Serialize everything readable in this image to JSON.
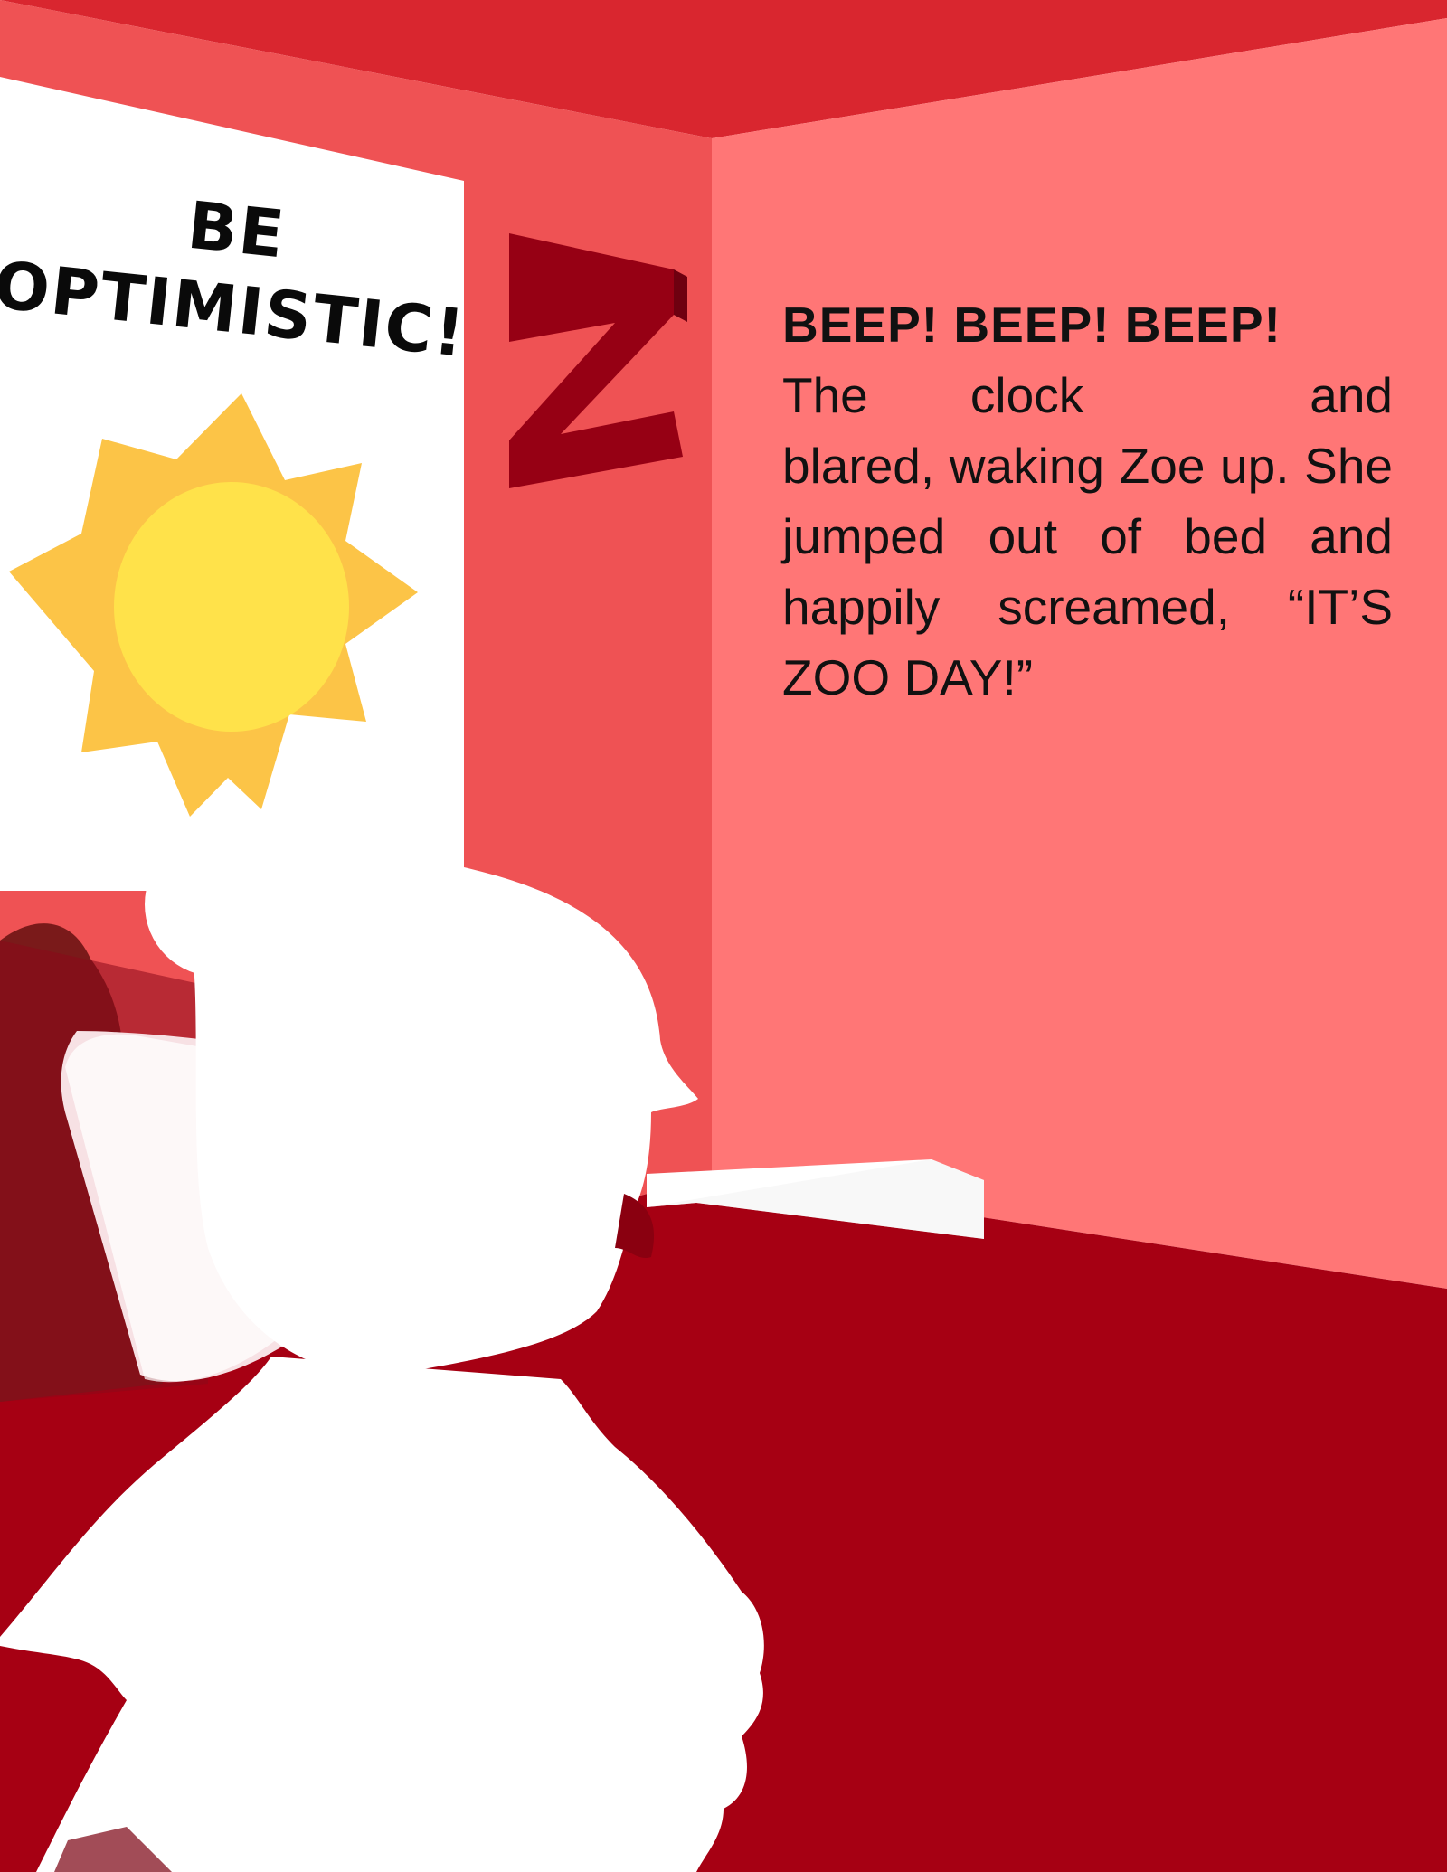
{
  "poster": {
    "line1": "BE",
    "line2": "OPTIMISTIC!"
  },
  "story": {
    "sound": "BEEP! BEEP! BEEP!",
    "sentence_start": "The clock",
    "sentence_rest": "and blared, waking Zoe up. She jumped out of bed and happily screamed,",
    "exclamation": "“IT’S ZOO DAY!”"
  },
  "wall_letter": "Z",
  "icons": [
    "sun-icon",
    "girl-silhouette",
    "z-letter-decoration"
  ],
  "colors": {
    "ceiling": "#d9262f",
    "left_wall": "#ef5254",
    "right_wall": "#ff7676",
    "floor": "#a60013",
    "bed": "#7a1a1a",
    "sun_rays": "#fcc447",
    "sun_core": "#ffe24a",
    "z_letter": "#960014"
  }
}
